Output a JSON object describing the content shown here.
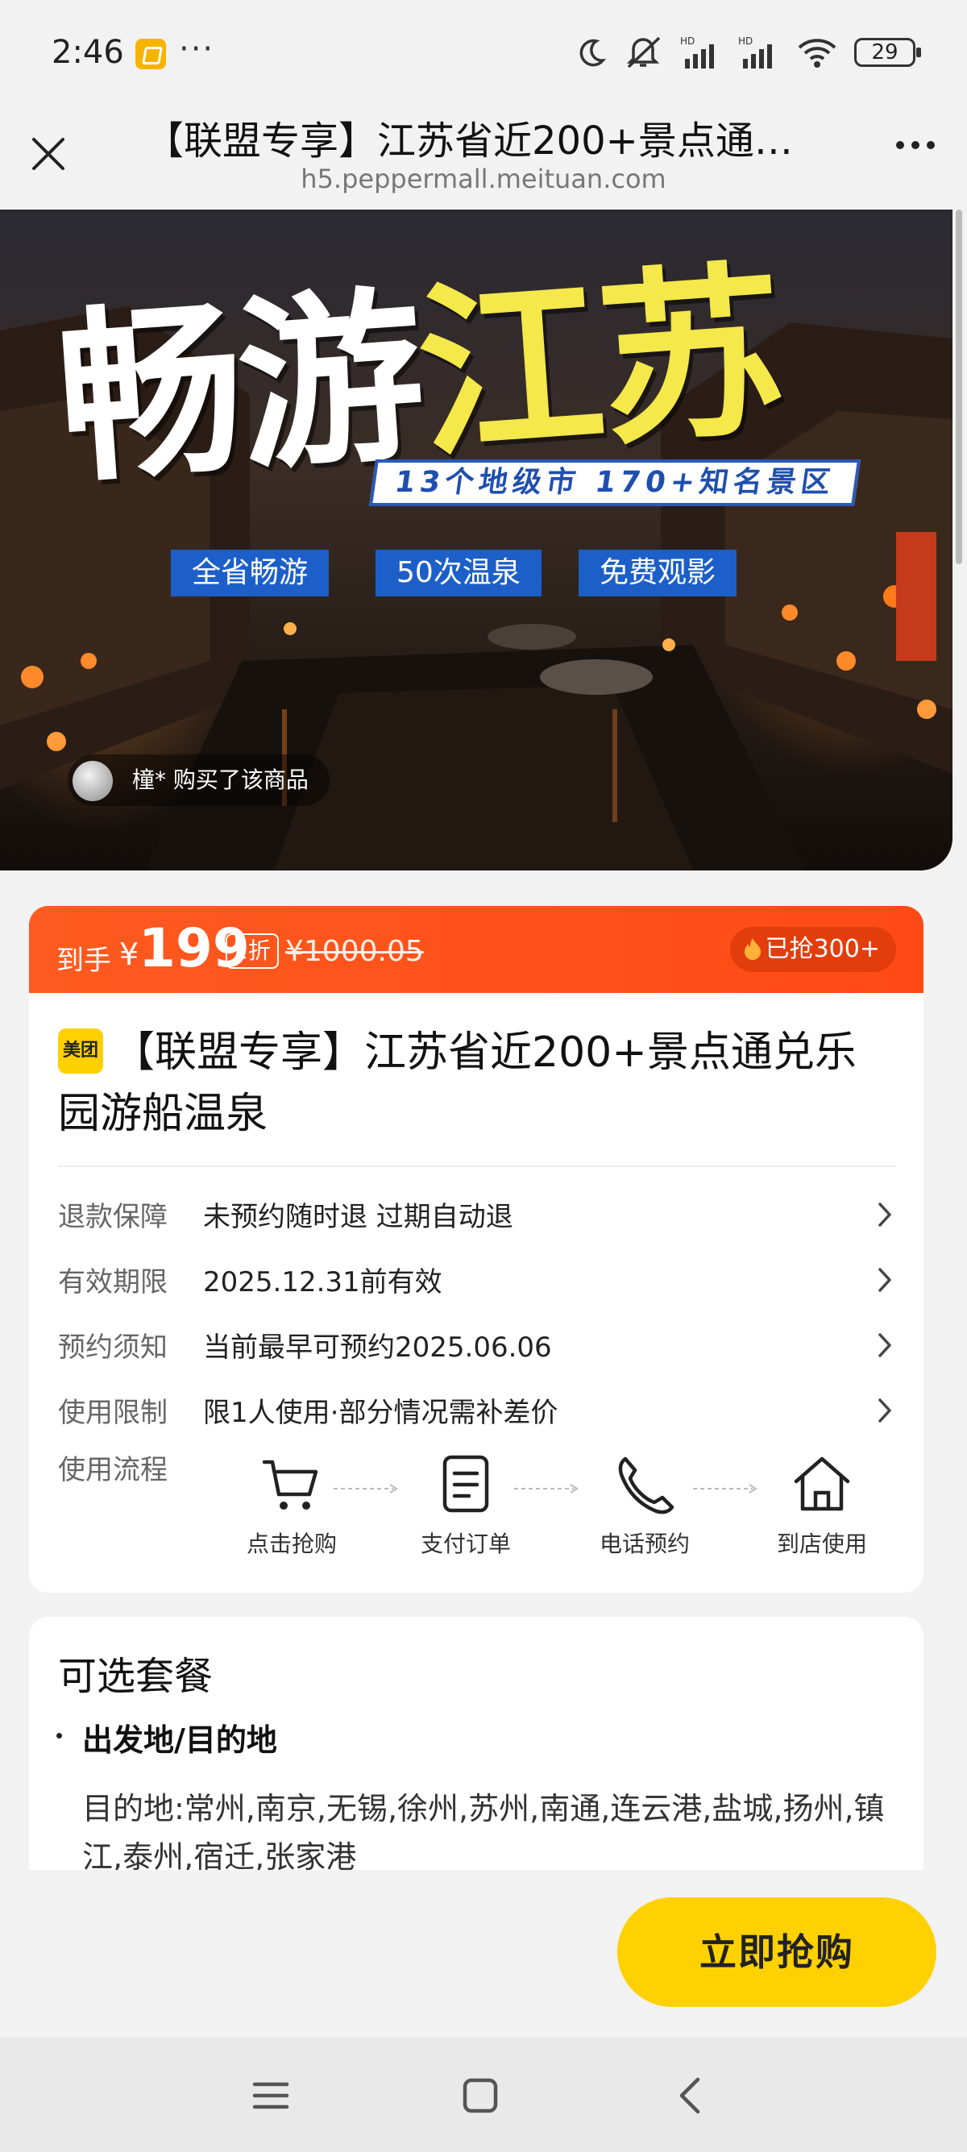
{
  "status_bar": {
    "time": "2:46",
    "more": "···",
    "battery": "29"
  },
  "nav": {
    "title": "【联盟专享】江苏省近200+景点通…",
    "url": "h5.peppermall.meituan.com"
  },
  "hero": {
    "title_white": "畅游",
    "title_yellow": "江苏",
    "subtitle": "13个地级市 170+知名景区",
    "tags": [
      "全省畅游",
      "50次温泉",
      "免费观影"
    ],
    "buyer_notice": "橦* 购买了该商品"
  },
  "price": {
    "label": "到手",
    "currency": "¥",
    "amount": "199",
    "discount": "2折",
    "original": "¥1000.05",
    "sold": "已抢300+"
  },
  "product": {
    "brand": "美团",
    "title": "【联盟专享】江苏省近200+景点通兑乐园游船温泉",
    "rows": [
      {
        "label": "退款保障",
        "value": "未预约随时退 过期自动退"
      },
      {
        "label": "有效期限",
        "value": "2025.12.31前有效"
      },
      {
        "label": "预约须知",
        "value": "当前最早可预约2025.06.06"
      },
      {
        "label": "使用限制",
        "value": "限1人使用·部分情况需补差价"
      }
    ],
    "flow_label": "使用流程",
    "flow_steps": [
      {
        "label": "点击抢购",
        "icon": "cart-icon"
      },
      {
        "label": "支付订单",
        "icon": "document-icon"
      },
      {
        "label": "电话预约",
        "icon": "phone-icon"
      },
      {
        "label": "到店使用",
        "icon": "home-icon"
      }
    ]
  },
  "packages": {
    "title": "可选套餐",
    "subheading": "出发地/目的地",
    "text": "目的地:常州,南京,无锡,徐州,苏州,南通,连云港,盐城,扬州,镇江,泰州,宿迁,张家港"
  },
  "buy_button": "立即抢购",
  "colors": {
    "accent": "#ff5a1f",
    "button": "#ffd100",
    "hero_tag": "#1d5fc8"
  }
}
